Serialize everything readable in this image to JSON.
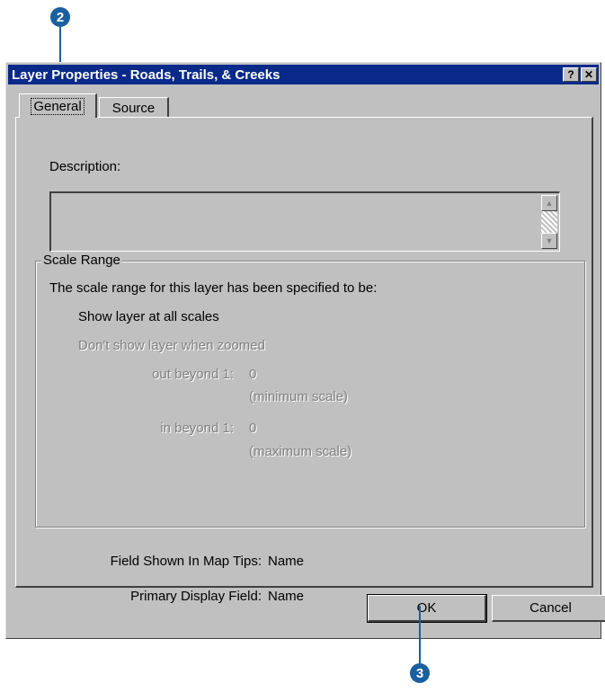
{
  "callouts": {
    "c2": "2",
    "c3": "3"
  },
  "window": {
    "title": "Layer Properties - Roads, Trails, & Creeks",
    "help_btn": "?",
    "close_btn": "✕"
  },
  "tabs": [
    {
      "label": "General",
      "active": true
    },
    {
      "label": "Source",
      "active": false
    }
  ],
  "general": {
    "description_label": "Description:",
    "description_value": "",
    "scale_range": {
      "title": "Scale Range",
      "intro": "The scale range for this layer has been specified to be:",
      "show_all": "Show layer at all scales",
      "dont_show": "Don't show layer when zoomed",
      "out_beyond_label": "out beyond 1:",
      "out_beyond_value": "0",
      "minimum_note": "(minimum scale)",
      "in_beyond_label": "in beyond 1:",
      "in_beyond_value": "0",
      "maximum_note": "(maximum scale)"
    },
    "map_tips_label": "Field Shown In Map Tips:",
    "map_tips_value": "Name",
    "primary_label": "Primary Display Field:",
    "primary_value": "Name"
  },
  "buttons": {
    "ok": "OK",
    "cancel": "Cancel"
  },
  "colors": {
    "titlebar": "#0a2a8a",
    "callout": "#1a5f9e",
    "dialog": "#c0c0c0"
  }
}
